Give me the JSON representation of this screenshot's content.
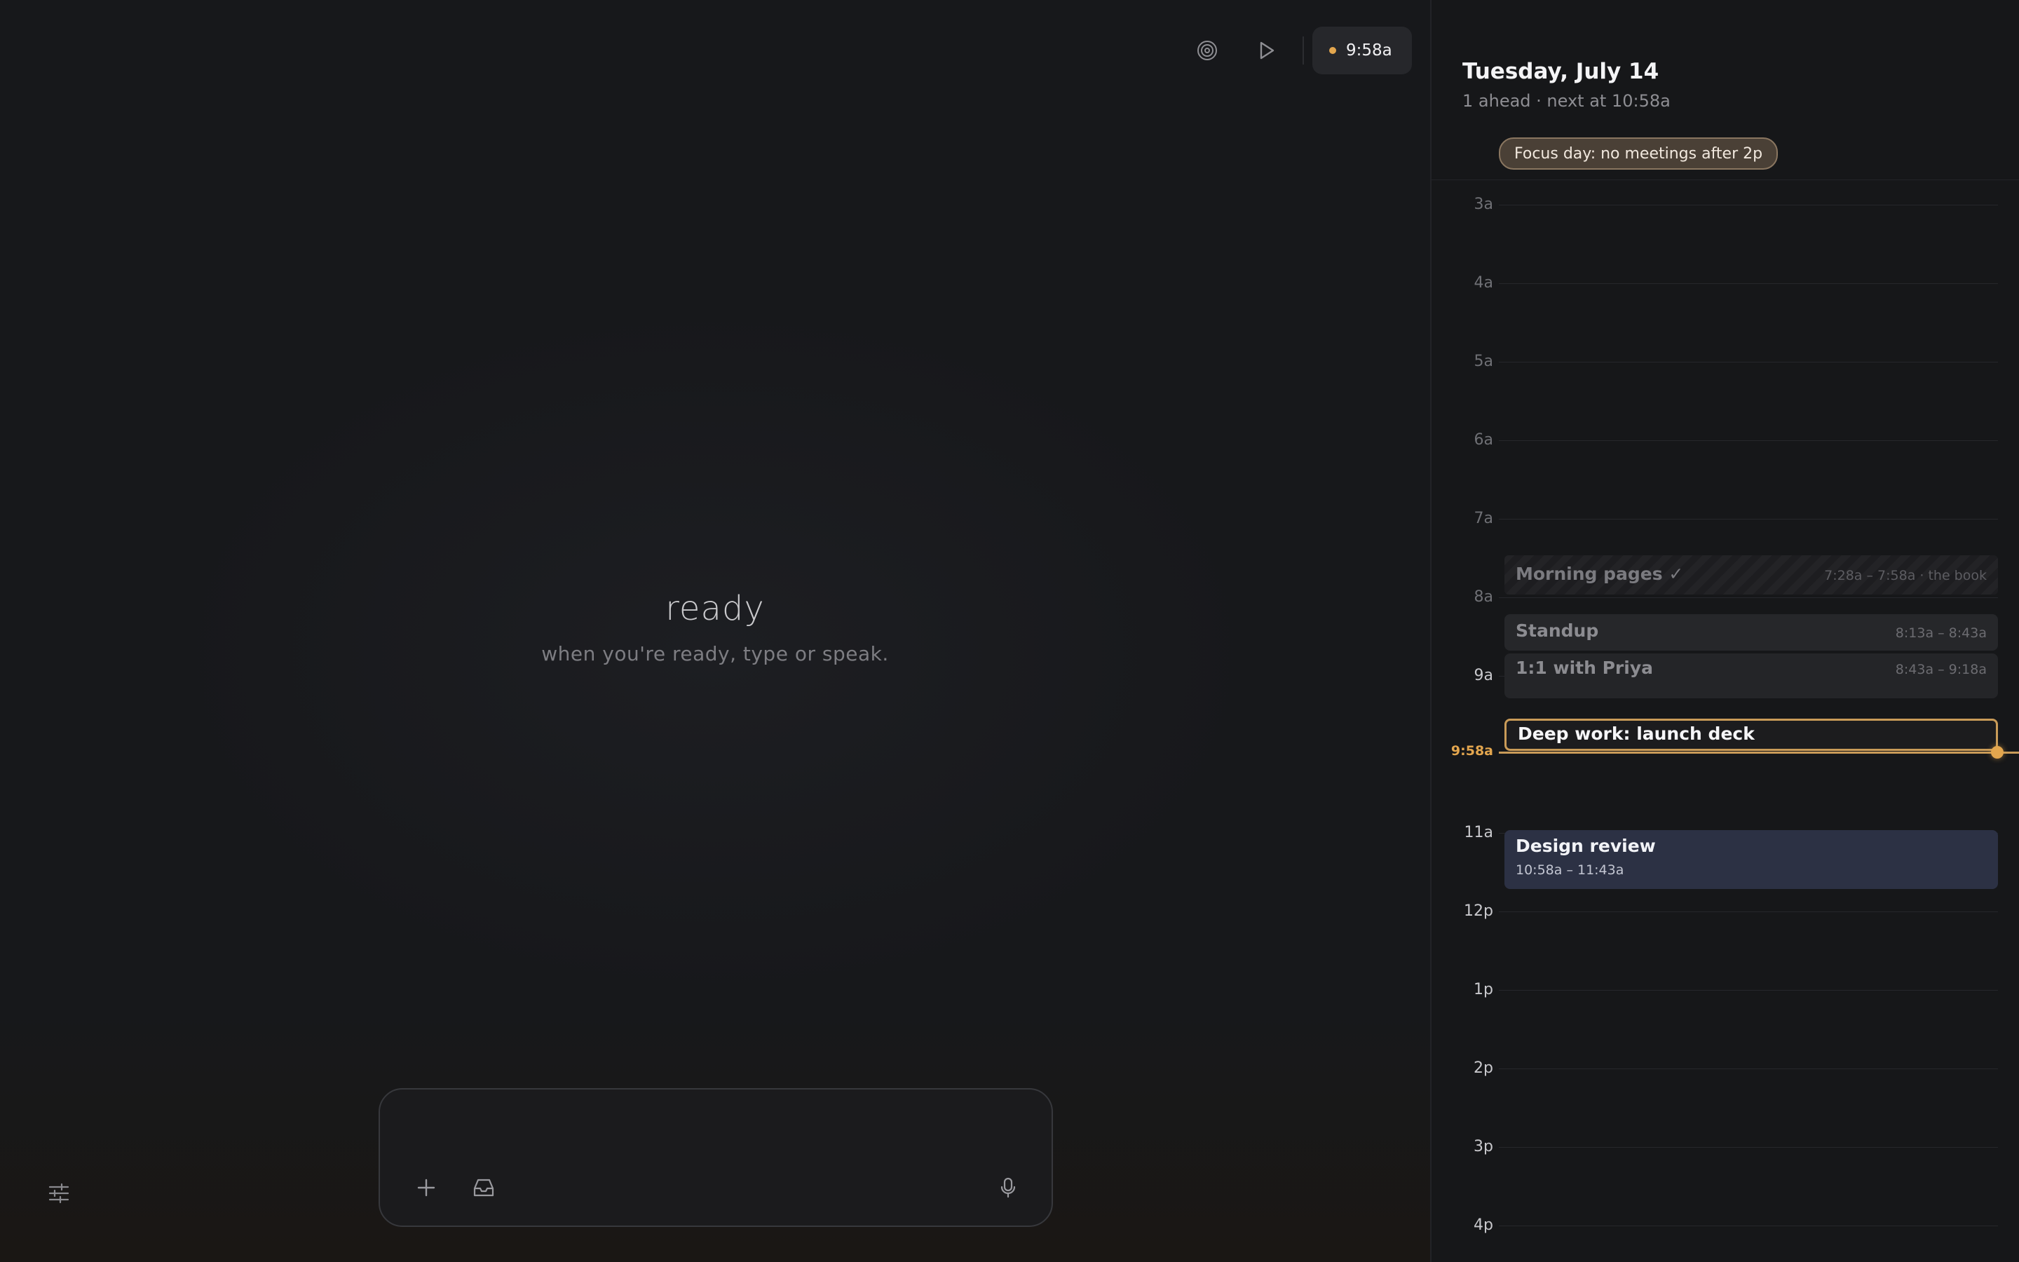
{
  "toolbar": {
    "focus_icon": "target-icon",
    "play_icon": "play-icon",
    "clock_time": "9:58a",
    "accent_color": "#e3a64e"
  },
  "main": {
    "status_title": "ready",
    "status_subtitle": "when you're ready, type or speak.",
    "composer": {
      "add_icon": "plus-icon",
      "inbox_icon": "inbox-icon",
      "mic_icon": "microphone-icon"
    },
    "settings_icon": "sliders-icon"
  },
  "calendar": {
    "date": "Tuesday, July 14",
    "summary": "1 ahead · next at 10:58a",
    "focus_note": "Focus day: no meetings after 2p",
    "hours": [
      "3a",
      "4a",
      "5a",
      "6a",
      "7a",
      "8a",
      "9a",
      "11a",
      "12p",
      "1p",
      "2p",
      "3p",
      "4p"
    ],
    "now_label": "9:58a",
    "events": {
      "morning": {
        "title": "Morning pages ✓",
        "time": "7:28a – 7:58a · the book"
      },
      "standup": {
        "title": "Standup",
        "time": "8:13a – 8:43a"
      },
      "priya": {
        "title": "1:1 with Priya",
        "time": "8:43a – 9:18a"
      },
      "deep": {
        "title": "Deep work: launch deck"
      },
      "design": {
        "title": "Design review",
        "time": "10:58a – 11:43a"
      }
    }
  }
}
